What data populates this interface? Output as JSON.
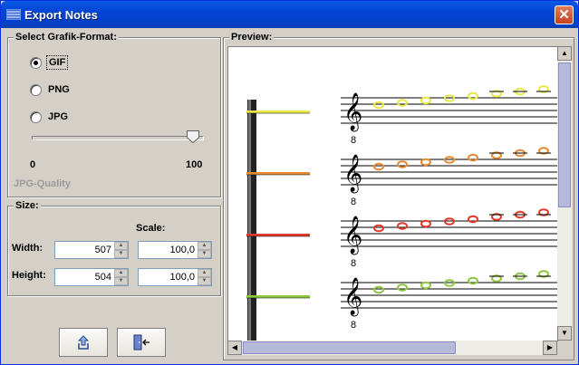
{
  "window": {
    "title": "Export Notes"
  },
  "format_group": {
    "title": "Select Grafik-Format:",
    "options": [
      {
        "label": "GIF",
        "selected": true
      },
      {
        "label": "PNG",
        "selected": false
      },
      {
        "label": "JPG",
        "selected": false
      }
    ],
    "slider": {
      "min_label": "0",
      "max_label": "100",
      "value_fraction": 1.0,
      "caption": "JPG-Quality"
    }
  },
  "size_group": {
    "title": "Size:",
    "scale_header": "Scale:",
    "width": {
      "label": "Width:",
      "value": "507",
      "scale": "100,0"
    },
    "height": {
      "label": "Height:",
      "value": "504",
      "scale": "100,0"
    }
  },
  "preview": {
    "title": "Preview:"
  },
  "colors": {
    "titlebar": "#0345d4",
    "staff_colors": [
      "#e8e84a",
      "#e88a30",
      "#e03a2a",
      "#8ec63f"
    ],
    "scroll_thumb": "#b6b9d8"
  },
  "icons": {
    "export": "export-icon",
    "exit": "exit-door-icon",
    "close": "close-icon"
  }
}
